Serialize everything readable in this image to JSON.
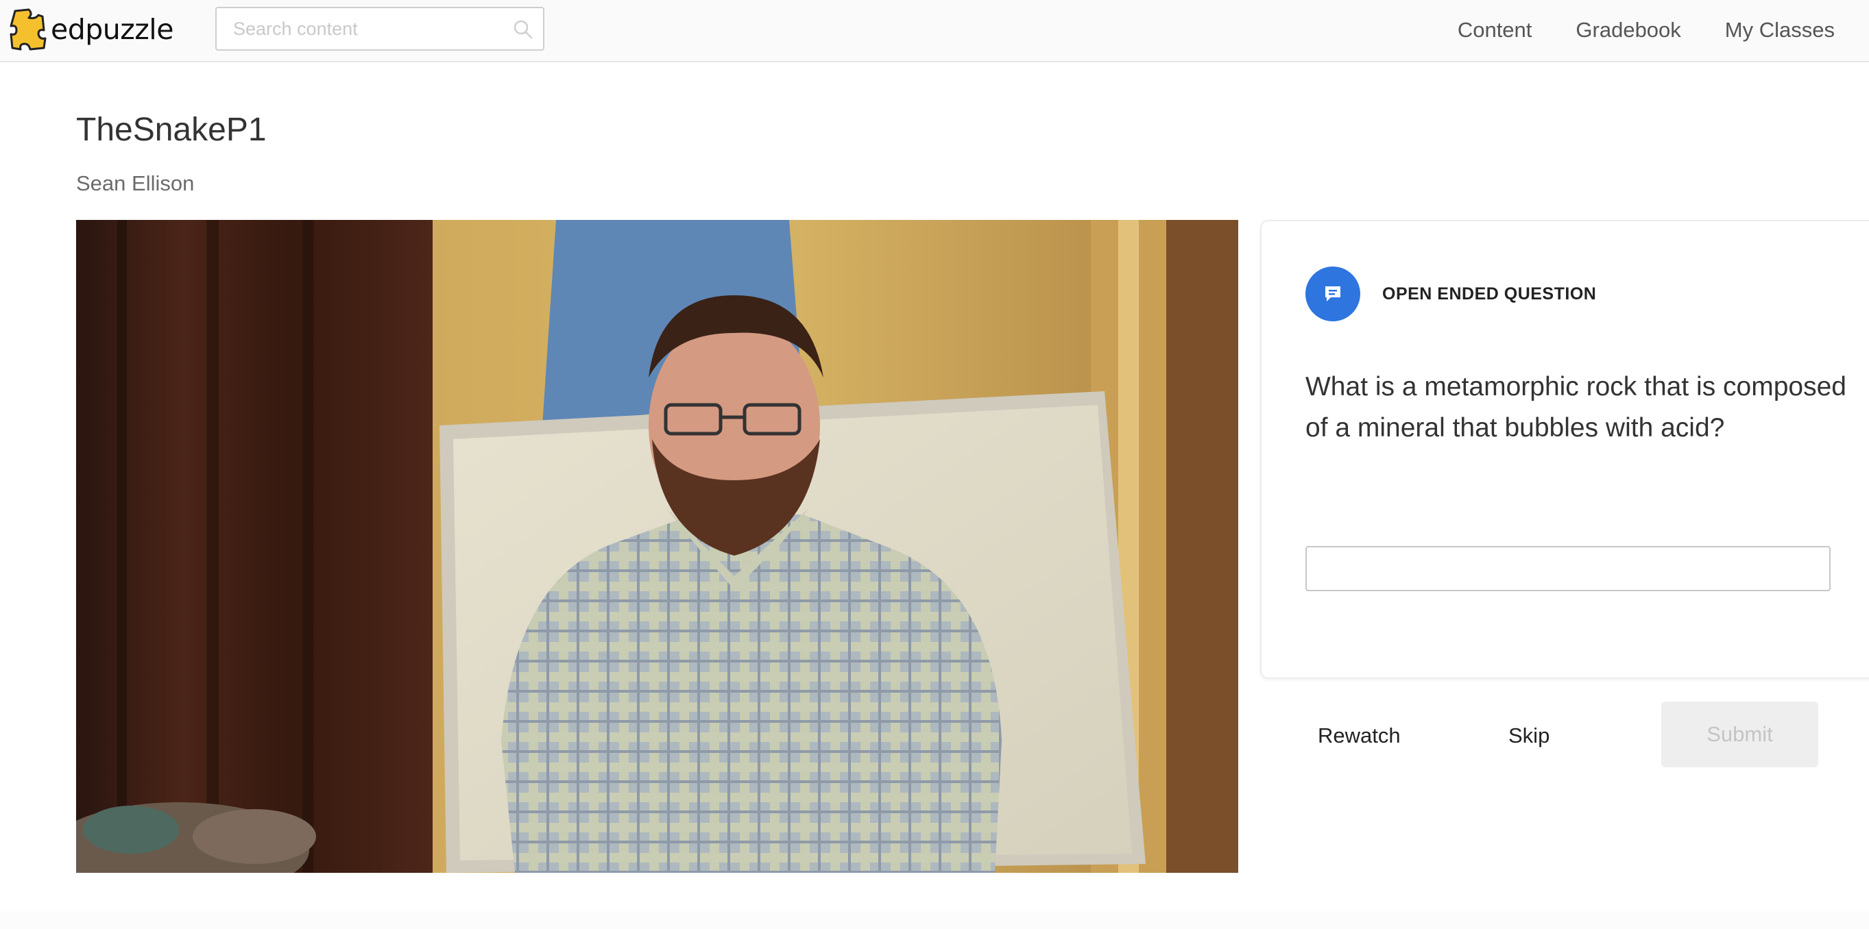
{
  "header": {
    "brand": "edpuzzle",
    "search_placeholder": "Search content",
    "nav": [
      "Content",
      "Gradebook",
      "My Classes"
    ]
  },
  "video": {
    "title": "TheSnakeP1",
    "author": "Sean Ellison"
  },
  "question": {
    "type_label": "OPEN ENDED QUESTION",
    "text": "What is a metamorphic rock that is composed of a mineral that bubbles with acid?",
    "answer_value": ""
  },
  "actions": {
    "rewatch": "Rewatch",
    "skip": "Skip",
    "submit": "Submit"
  },
  "colors": {
    "accent_blue": "#2f75e0",
    "logo_yellow": "#f5c02e"
  }
}
